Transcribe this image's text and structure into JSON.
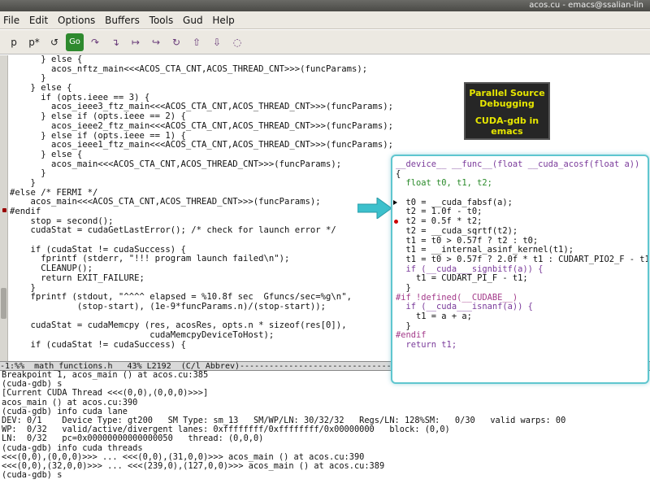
{
  "window": {
    "title": "acos.cu - emacs@ssalian-lin"
  },
  "menu": [
    "File",
    "Edit",
    "Options",
    "Buffers",
    "Tools",
    "Gud",
    "Help"
  ],
  "toolbar_icons": [
    {
      "name": "step-p-icon",
      "glyph": "p"
    },
    {
      "name": "step-pstar-icon",
      "glyph": "p*"
    },
    {
      "name": "refresh-icon",
      "glyph": "↺"
    },
    {
      "name": "go-icon",
      "glyph": "Go"
    },
    {
      "name": "step-over-icon",
      "glyph": "↷"
    },
    {
      "name": "step-in-icon",
      "glyph": "↴"
    },
    {
      "name": "next-icon",
      "glyph": "↦"
    },
    {
      "name": "until-icon",
      "glyph": "↪"
    },
    {
      "name": "finish-icon",
      "glyph": "↻"
    },
    {
      "name": "up-frame-icon",
      "glyph": "⇧"
    },
    {
      "name": "down-frame-icon",
      "glyph": "⇩"
    },
    {
      "name": "help-bulb-icon",
      "glyph": "◌"
    }
  ],
  "code_lines": [
    "      } else {",
    "        acos_nftz_main<<<ACOS_CTA_CNT,ACOS_THREAD_CNT>>>(funcParams);",
    "      }",
    "    } else {",
    "      if (opts.ieee == 3) {",
    "        acos_ieee3_ftz_main<<<ACOS_CTA_CNT,ACOS_THREAD_CNT>>>(funcParams);",
    "      } else if (opts.ieee == 2) {",
    "        acos_ieee2_ftz_main<<<ACOS_CTA_CNT,ACOS_THREAD_CNT>>>(funcParams);",
    "      } else if (opts.ieee == 1) {",
    "        acos_ieee1_ftz_main<<<ACOS_CTA_CNT,ACOS_THREAD_CNT>>>(funcParams);",
    "      } else {",
    "        acos_main<<<ACOS_CTA_CNT,ACOS_THREAD_CNT>>>(funcParams);",
    "      }",
    "    }",
    "#else /* FERMI */",
    "    acos_main<<<ACOS_CTA_CNT,ACOS_THREAD_CNT>>>(funcParams);",
    "#endif",
    "    stop = second();",
    "    cudaStat = cudaGetLastError(); /* check for launch error */",
    "",
    "    if (cudaStat != cudaSuccess) {",
    "      fprintf (stderr, \"!!! program launch failed\\n\");",
    "      CLEANUP();",
    "      return EXIT_FAILURE;",
    "    }",
    "    fprintf (stdout, \"^^^^ elapsed = %10.8f sec  Gfuncs/sec=%g\\n\",",
    "             (stop-start), (1e-9*funcParams.n)/(stop-start));",
    "",
    "    cudaStat = cudaMemcpy (res, acosRes, opts.n * sizeof(res[0]),",
    "                           cudaMemcpyDeviceToHost);",
    "    if (cudaStat != cudaSuccess) {"
  ],
  "source_modeline": "-1:%%  math_functions.h   43% L2192  (C/l Abbrev)-------------------------------------------------------",
  "gdb_lines": [
    "Breakpoint 1, acos_main () at acos.cu:385",
    "(cuda-gdb) s",
    "[Current CUDA Thread <<<(0,0),(0,0,0)>>>]",
    "acos_main () at acos.cu:390",
    "(cuda-gdb) info cuda lane",
    "DEV: 0/1    Device Type: gt200   SM Type: sm_13   SM/WP/LN: 30/32/32   Regs/LN: 128%SM:   0/30   valid warps: 00",
    "WP:  0/32   valid/active/divergent lanes: 0xffffffff/0xffffffff/0x00000000   block: (0,0)",
    "LN:  0/32   pc=0x00000000000000050   thread: (0,0,0)",
    "(cuda-gdb) info cuda threads",
    "<<<(0,0),(0,0,0)>>> ... <<<(0,0),(31,0,0)>>> acos_main () at acos.cu:390",
    "<<<(0,0),(32,0,0)>>> ... <<<(239,0),(127,0,0)>>> acos_main () at acos.cu:389",
    "(cuda-gdb) s"
  ],
  "callout": {
    "line1": "Parallel Source",
    "line2": "Debugging",
    "line3": "CUDA-gdb in",
    "line4": "emacs"
  },
  "panel_lines": [
    "__device__ __func__(float __cuda_acosf(float a))",
    "{",
    "  float t0, t1, t2;",
    "",
    "  t0 = __cuda_fabsf(a);",
    "  t2 = 1.0f - t0;",
    "  t2 = 0.5f * t2;",
    "  t2 = __cuda_sqrtf(t2);",
    "  t1 = t0 > 0.57f ? t2 : t0;",
    "  t1 = __internal_asinf_kernel(t1);",
    "  t1 = t0 > 0.57f ? 2.0f * t1 : CUDART_PIO2_F - t1;",
    "  if (__cuda___signbitf(a)) {",
    "    t1 = CUDART_PI_F - t1;",
    "  }",
    "#if !defined(__CUDABE__)",
    "  if (__cuda___isnanf(a)) {",
    "    t1 = a + a;",
    "  }",
    "#endif",
    "  return t1;"
  ],
  "colors": {
    "panel_border": "#5fc6cf",
    "arrow": "#3cc0cc",
    "callout_bg": "#262626",
    "callout_text": "#e6e600",
    "breakpoint": "#cc0000"
  }
}
